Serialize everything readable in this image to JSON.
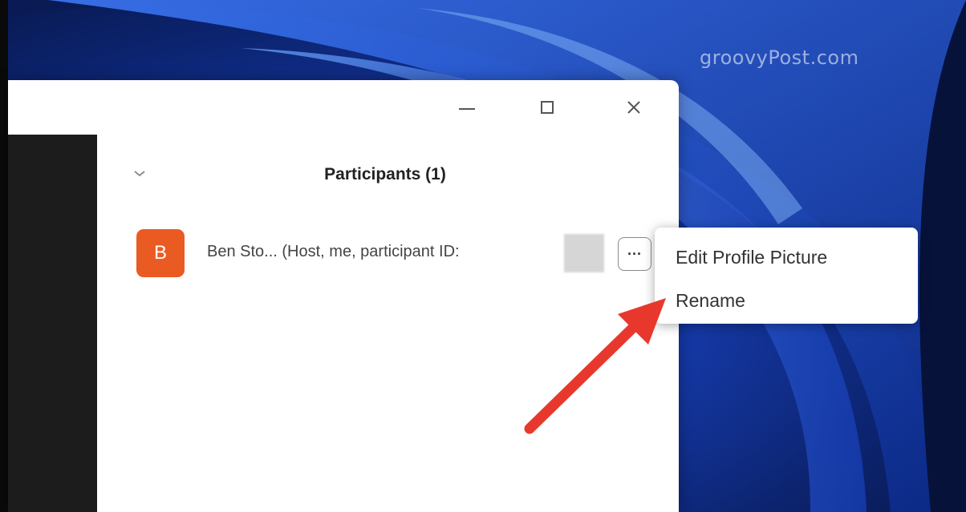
{
  "watermark": "groovyPost.com",
  "window": {
    "controls": {
      "minimize_icon": "minimize-icon",
      "maximize_icon": "maximize-icon",
      "close_icon": "close-icon"
    }
  },
  "participants_panel": {
    "title": "Participants (1)",
    "collapse_icon": "chevron-down-icon",
    "participants": [
      {
        "avatar_initial": "B",
        "avatar_color": "#ea5b24",
        "name_text": "Ben Sto...  (Host, me, participant ID:"
      }
    ],
    "more_button_label": "···"
  },
  "context_menu": {
    "items": [
      {
        "label": "Edit Profile Picture"
      },
      {
        "label": "Rename"
      }
    ]
  },
  "annotation": {
    "arrow_color": "#e8382d"
  }
}
